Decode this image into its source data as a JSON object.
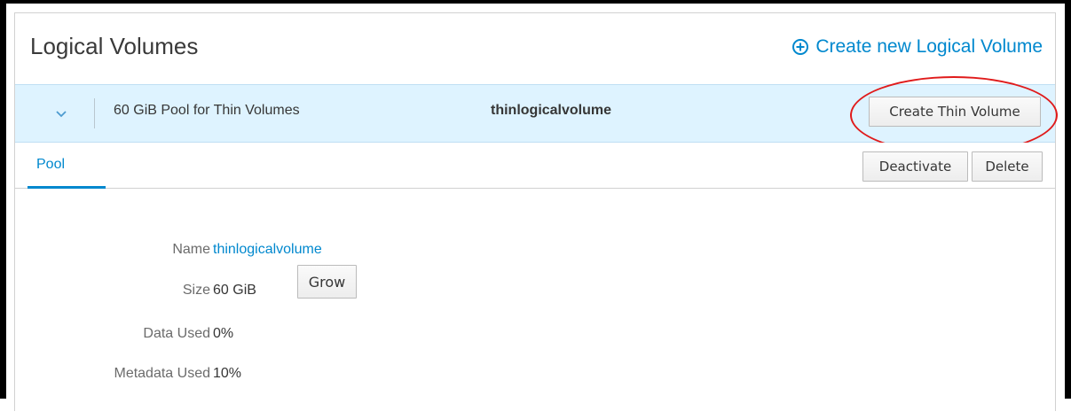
{
  "panel": {
    "title": "Logical Volumes",
    "create_link": "Create new Logical Volume",
    "accent_color": "#0088ce"
  },
  "lv_row": {
    "description": "60 GiB Pool for Thin Volumes",
    "name": "thinlogicalvolume",
    "create_thin_button": "Create Thin Volume",
    "expanded": true
  },
  "tabs": [
    {
      "label": "Pool",
      "active": true
    }
  ],
  "actions": {
    "deactivate": "Deactivate",
    "delete": "Delete"
  },
  "details": {
    "name_label": "Name",
    "name_value": "thinlogicalvolume",
    "size_label": "Size",
    "size_value": "60 GiB",
    "grow_button": "Grow",
    "data_used_label": "Data Used",
    "data_used_value": "0%",
    "metadata_used_label": "Metadata Used",
    "metadata_used_value": "10%"
  },
  "annotation": {
    "highlight_color": "#e01b1b"
  }
}
